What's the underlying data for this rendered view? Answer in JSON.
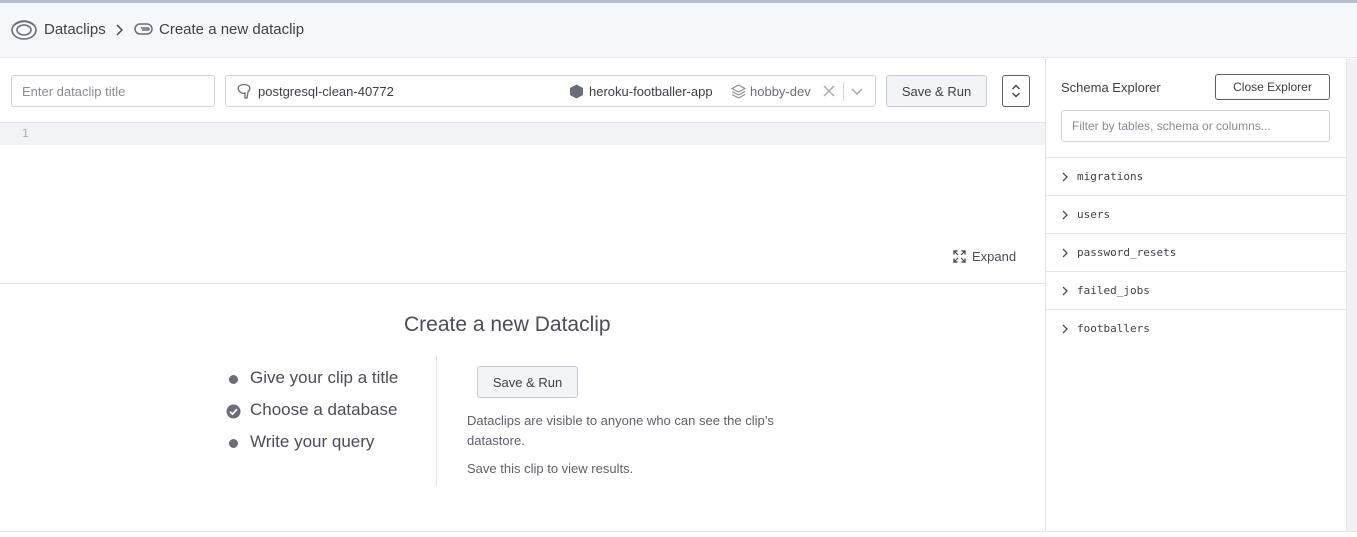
{
  "breadcrumb": {
    "root": "Dataclips",
    "current": "Create a new dataclip"
  },
  "toolbar": {
    "title_placeholder": "Enter dataclip title",
    "database": "postgresql-clean-40772",
    "app": "heroku-footballer-app",
    "plan": "hobby-dev",
    "save_run_label": "Save & Run"
  },
  "editor": {
    "line_numbers": [
      "1"
    ],
    "expand_label": "Expand"
  },
  "empty_state": {
    "title": "Create a new Dataclip",
    "steps": [
      {
        "label": "Give your clip a title",
        "done": false
      },
      {
        "label": "Choose a database",
        "done": true
      },
      {
        "label": "Write your query",
        "done": false
      }
    ],
    "save_run_label": "Save & Run",
    "note_visibility": "Dataclips are visible to anyone who can see the clip’s datastore.",
    "note_results": "Save this clip to view results."
  },
  "schema_explorer": {
    "title": "Schema Explorer",
    "close_label": "Close Explorer",
    "filter_placeholder": "Filter by tables, schema or columns...",
    "tables": [
      "migrations",
      "users",
      "password_resets",
      "failed_jobs",
      "footballers"
    ]
  },
  "icons": {
    "brand": "dataclips-logo-icon",
    "breadcrumb_separator": "chevron-right-icon",
    "clip": "dataclip-icon",
    "database": "postgres-elephant-icon",
    "app": "heroku-app-hex-icon",
    "plan": "stack-plan-icon",
    "clear": "close-icon",
    "dropdown": "chevron-down-icon",
    "toggle": "sort-up-down-icon",
    "expand": "expand-icon",
    "step_done": "check-circle-icon",
    "table": "chevron-right-icon"
  },
  "colors": {
    "text": "#3f3f44",
    "header_bg": "#f7f8fb",
    "border": "#d0d3dc",
    "muted": "#6b6e78"
  }
}
